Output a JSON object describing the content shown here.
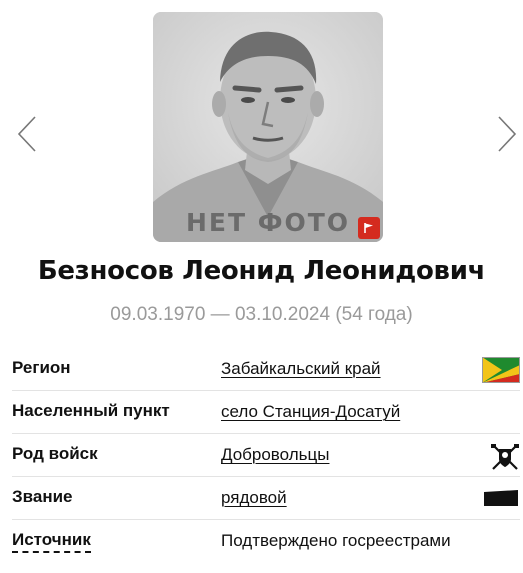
{
  "carousel": {
    "prev_icon": "chevron-left-icon",
    "next_icon": "chevron-right-icon",
    "placeholder_text": "НЕТ ФОТО",
    "badge_icon": "flag-icon",
    "badge_color": "#d42b1f"
  },
  "person": {
    "name": "Безносов Леонид Леонидович",
    "lifespan": "09.03.1970 — 03.10.2024 (54 года)"
  },
  "details": [
    {
      "label": "Регион",
      "value": "Забайкальский край",
      "icon": "region-flag-icon"
    },
    {
      "label": "Населенный пункт",
      "value": "село Станция-Досатуй",
      "icon": ""
    },
    {
      "label": "Род войск",
      "value": "Добровольцы",
      "icon": "volunteers-emblem-icon"
    },
    {
      "label": "Звание",
      "value": "рядовой",
      "icon": "rank-insignia-icon"
    },
    {
      "label": "Источник",
      "value": "Подтверждено госреестрами",
      "icon": ""
    }
  ],
  "colors": {
    "text": "#111111",
    "muted": "#9a9a9a",
    "divider": "#e3e3e3",
    "region_flag_green": "#1f8a2e",
    "region_flag_yellow": "#f2c418",
    "region_flag_red": "#d42b1f"
  }
}
